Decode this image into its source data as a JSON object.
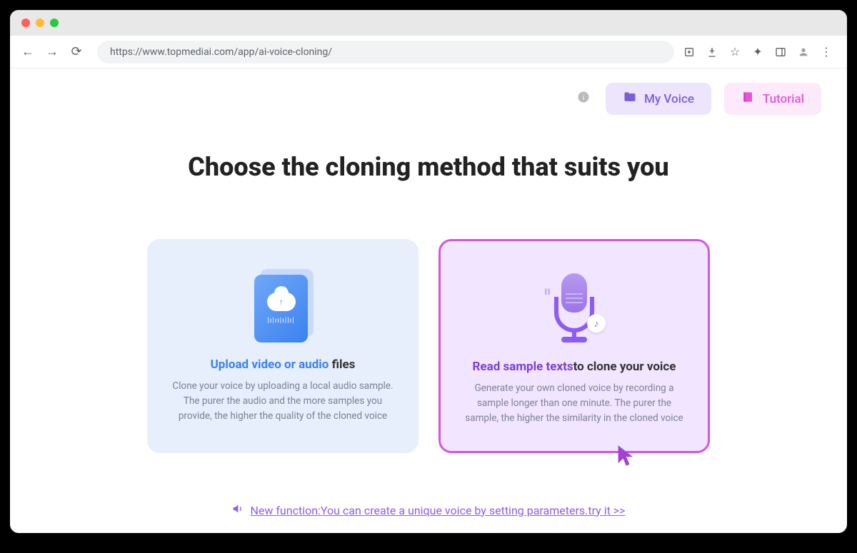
{
  "browser": {
    "url": "https://www.topmediai.com/app/ai-voice-cloning/"
  },
  "header": {
    "my_voice_label": "My Voice",
    "tutorial_label": "Tutorial"
  },
  "page": {
    "title": "Choose the cloning method that suits you"
  },
  "cards": {
    "upload": {
      "title_highlight": "Upload video or audio",
      "title_rest": " files",
      "desc": "Clone your voice by uploading a local audio sample. The purer the audio and the more samples you provide, the higher the quality of the cloned voice"
    },
    "record": {
      "title_highlight": "Read sample texts",
      "title_rest": "to clone your voice",
      "desc": "Generate your own cloned voice by recording a sample longer than one minute. The purer the sample, the higher the similarity in the cloned voice"
    }
  },
  "footer": {
    "new_function_link": "New function:You can create a unique voice by setting parameters.try it >>"
  }
}
